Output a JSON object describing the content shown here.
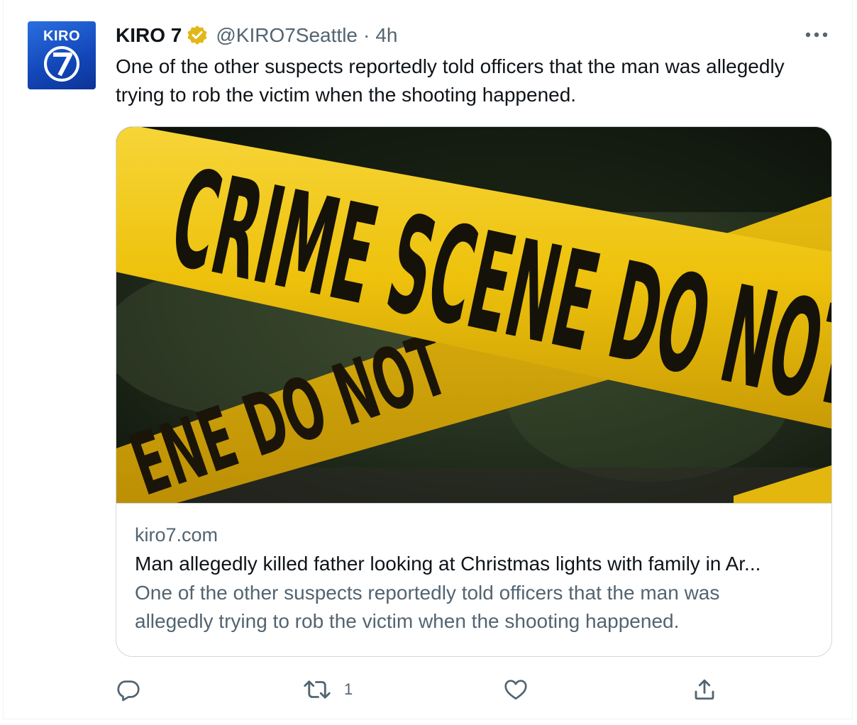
{
  "tweet": {
    "avatar_label": "KIRO",
    "author_name": "KIRO 7",
    "handle": "@KIRO7Seattle",
    "separator": "·",
    "timestamp": "4h",
    "text": "One of the other suspects reportedly told officers that the man was allegedly trying to rob the victim when the shooting happened.",
    "verified_color": "#e2b719"
  },
  "card": {
    "image_texts": [
      "CRIME SCENE DO NOT CR",
      "ENE DO NOT",
      "SC",
      "DO"
    ],
    "domain": "kiro7.com",
    "title": "Man allegedly killed father looking at Christmas lights with family in Ar...",
    "description": "One of the other suspects reportedly told officers that the man was allegedly trying to rob the victim when the shooting happened."
  },
  "actions": {
    "reply_icon": "reply-icon",
    "retweet_icon": "retweet-icon",
    "retweet_count": "1",
    "like_icon": "heart-icon",
    "share_icon": "share-icon"
  },
  "colors": {
    "secondary_text": "#536471",
    "border": "#cfd9de",
    "tape_yellow": "#f2c60f"
  }
}
